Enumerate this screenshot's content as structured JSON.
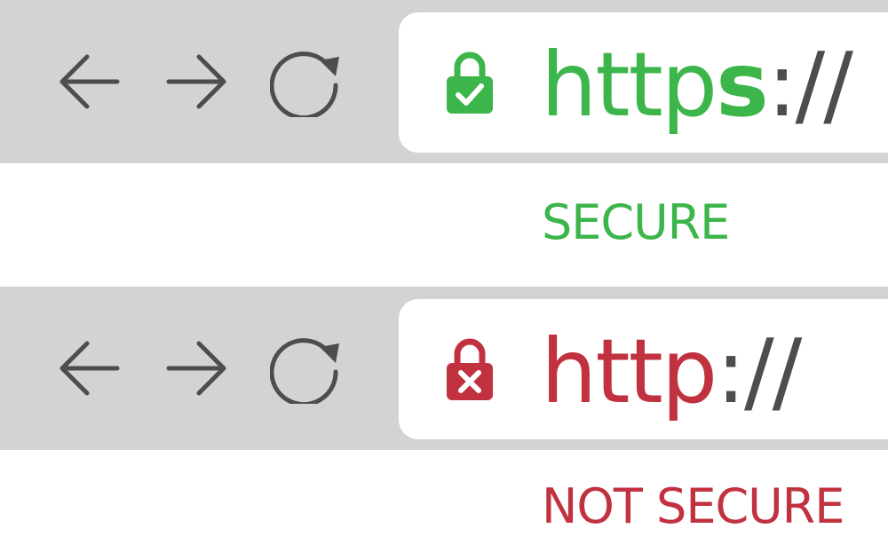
{
  "colors": {
    "toolbar_bg": "#d2d3d5",
    "icon_gray": "#4d4d4f",
    "secure_green": "#3cb54a",
    "insecure_red": "#c1313f"
  },
  "secure_bar": {
    "icons": [
      "back-arrow-icon",
      "forward-arrow-icon",
      "reload-icon",
      "lock-check-icon"
    ],
    "url_prefix": "http",
    "url_prefix_emphasis": "s",
    "url_separator": "://",
    "status_label": "SECURE"
  },
  "insecure_bar": {
    "icons": [
      "back-arrow-icon",
      "forward-arrow-icon",
      "reload-icon",
      "lock-x-icon"
    ],
    "url_prefix": "http",
    "url_separator": "://",
    "status_label": "NOT SECURE"
  }
}
